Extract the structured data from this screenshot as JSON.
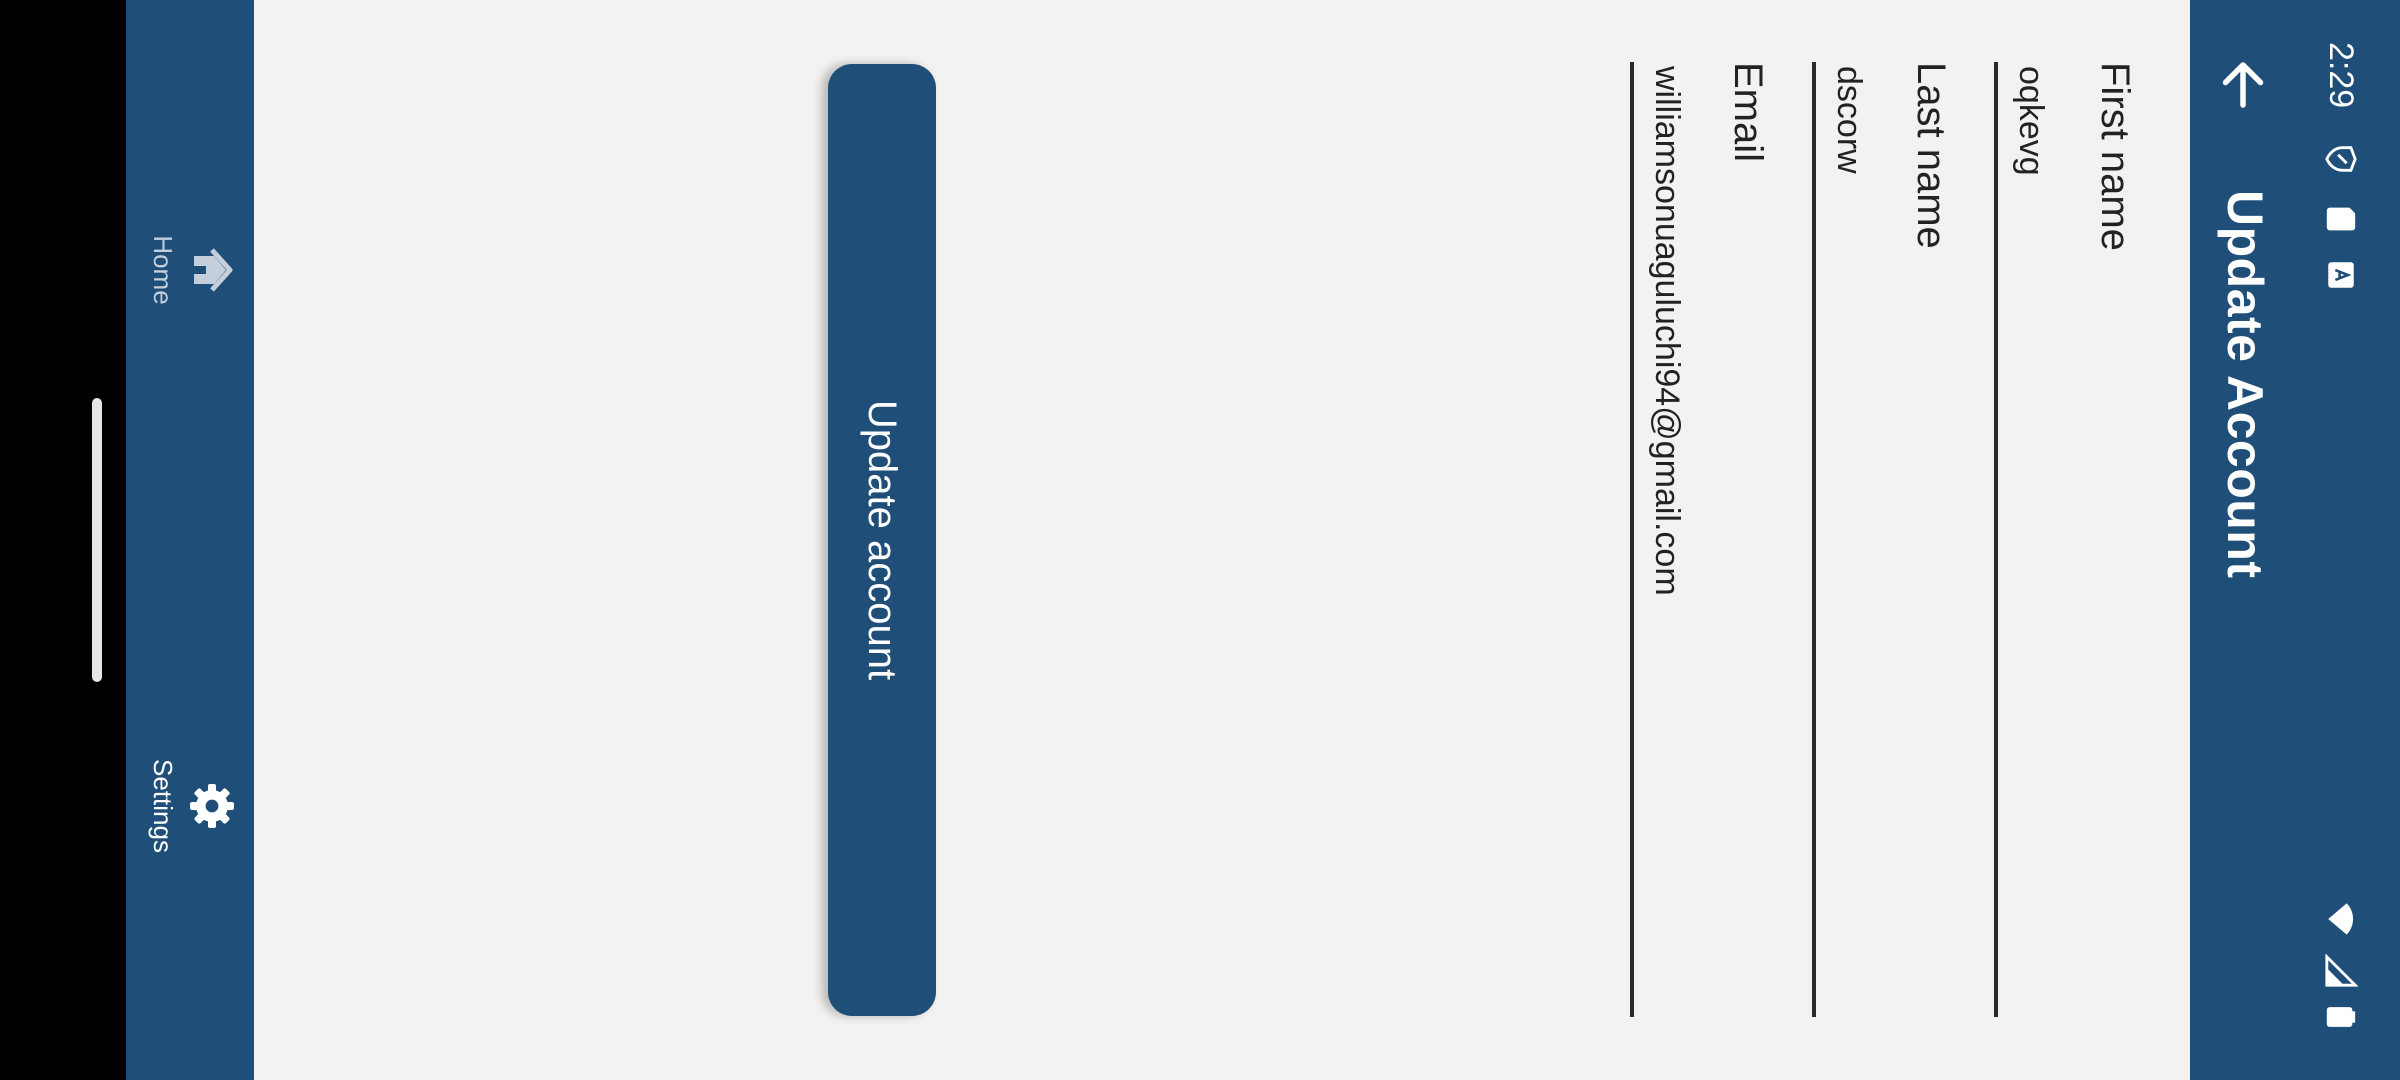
{
  "status_bar": {
    "time": "2:29",
    "left_icons": [
      "vpn-shield-icon",
      "sd-card-icon",
      "keyboard-icon"
    ],
    "right_icons": [
      "wifi-icon",
      "cell-signal-icon",
      "battery-icon"
    ]
  },
  "header": {
    "title": "Update Account",
    "back_icon": "arrow-left-icon"
  },
  "form": {
    "fields": [
      {
        "label": "First name",
        "value": "oqkevg"
      },
      {
        "label": "Last name",
        "value": "dscorw"
      },
      {
        "label": "Email",
        "value": "williamsonuaguluchi94@gmail.com"
      }
    ],
    "submit_label": "Update account"
  },
  "bottom_nav": {
    "items": [
      {
        "label": "Home",
        "icon": "home-icon",
        "state": "inactive"
      },
      {
        "label": "Settings",
        "icon": "gear-icon",
        "state": "active"
      }
    ]
  },
  "colors": {
    "primary": "#1f4f78",
    "background": "#f2f2f2",
    "text": "#222222",
    "nav_inactive": "#c4cfdb",
    "nav_active": "#ffffff"
  }
}
